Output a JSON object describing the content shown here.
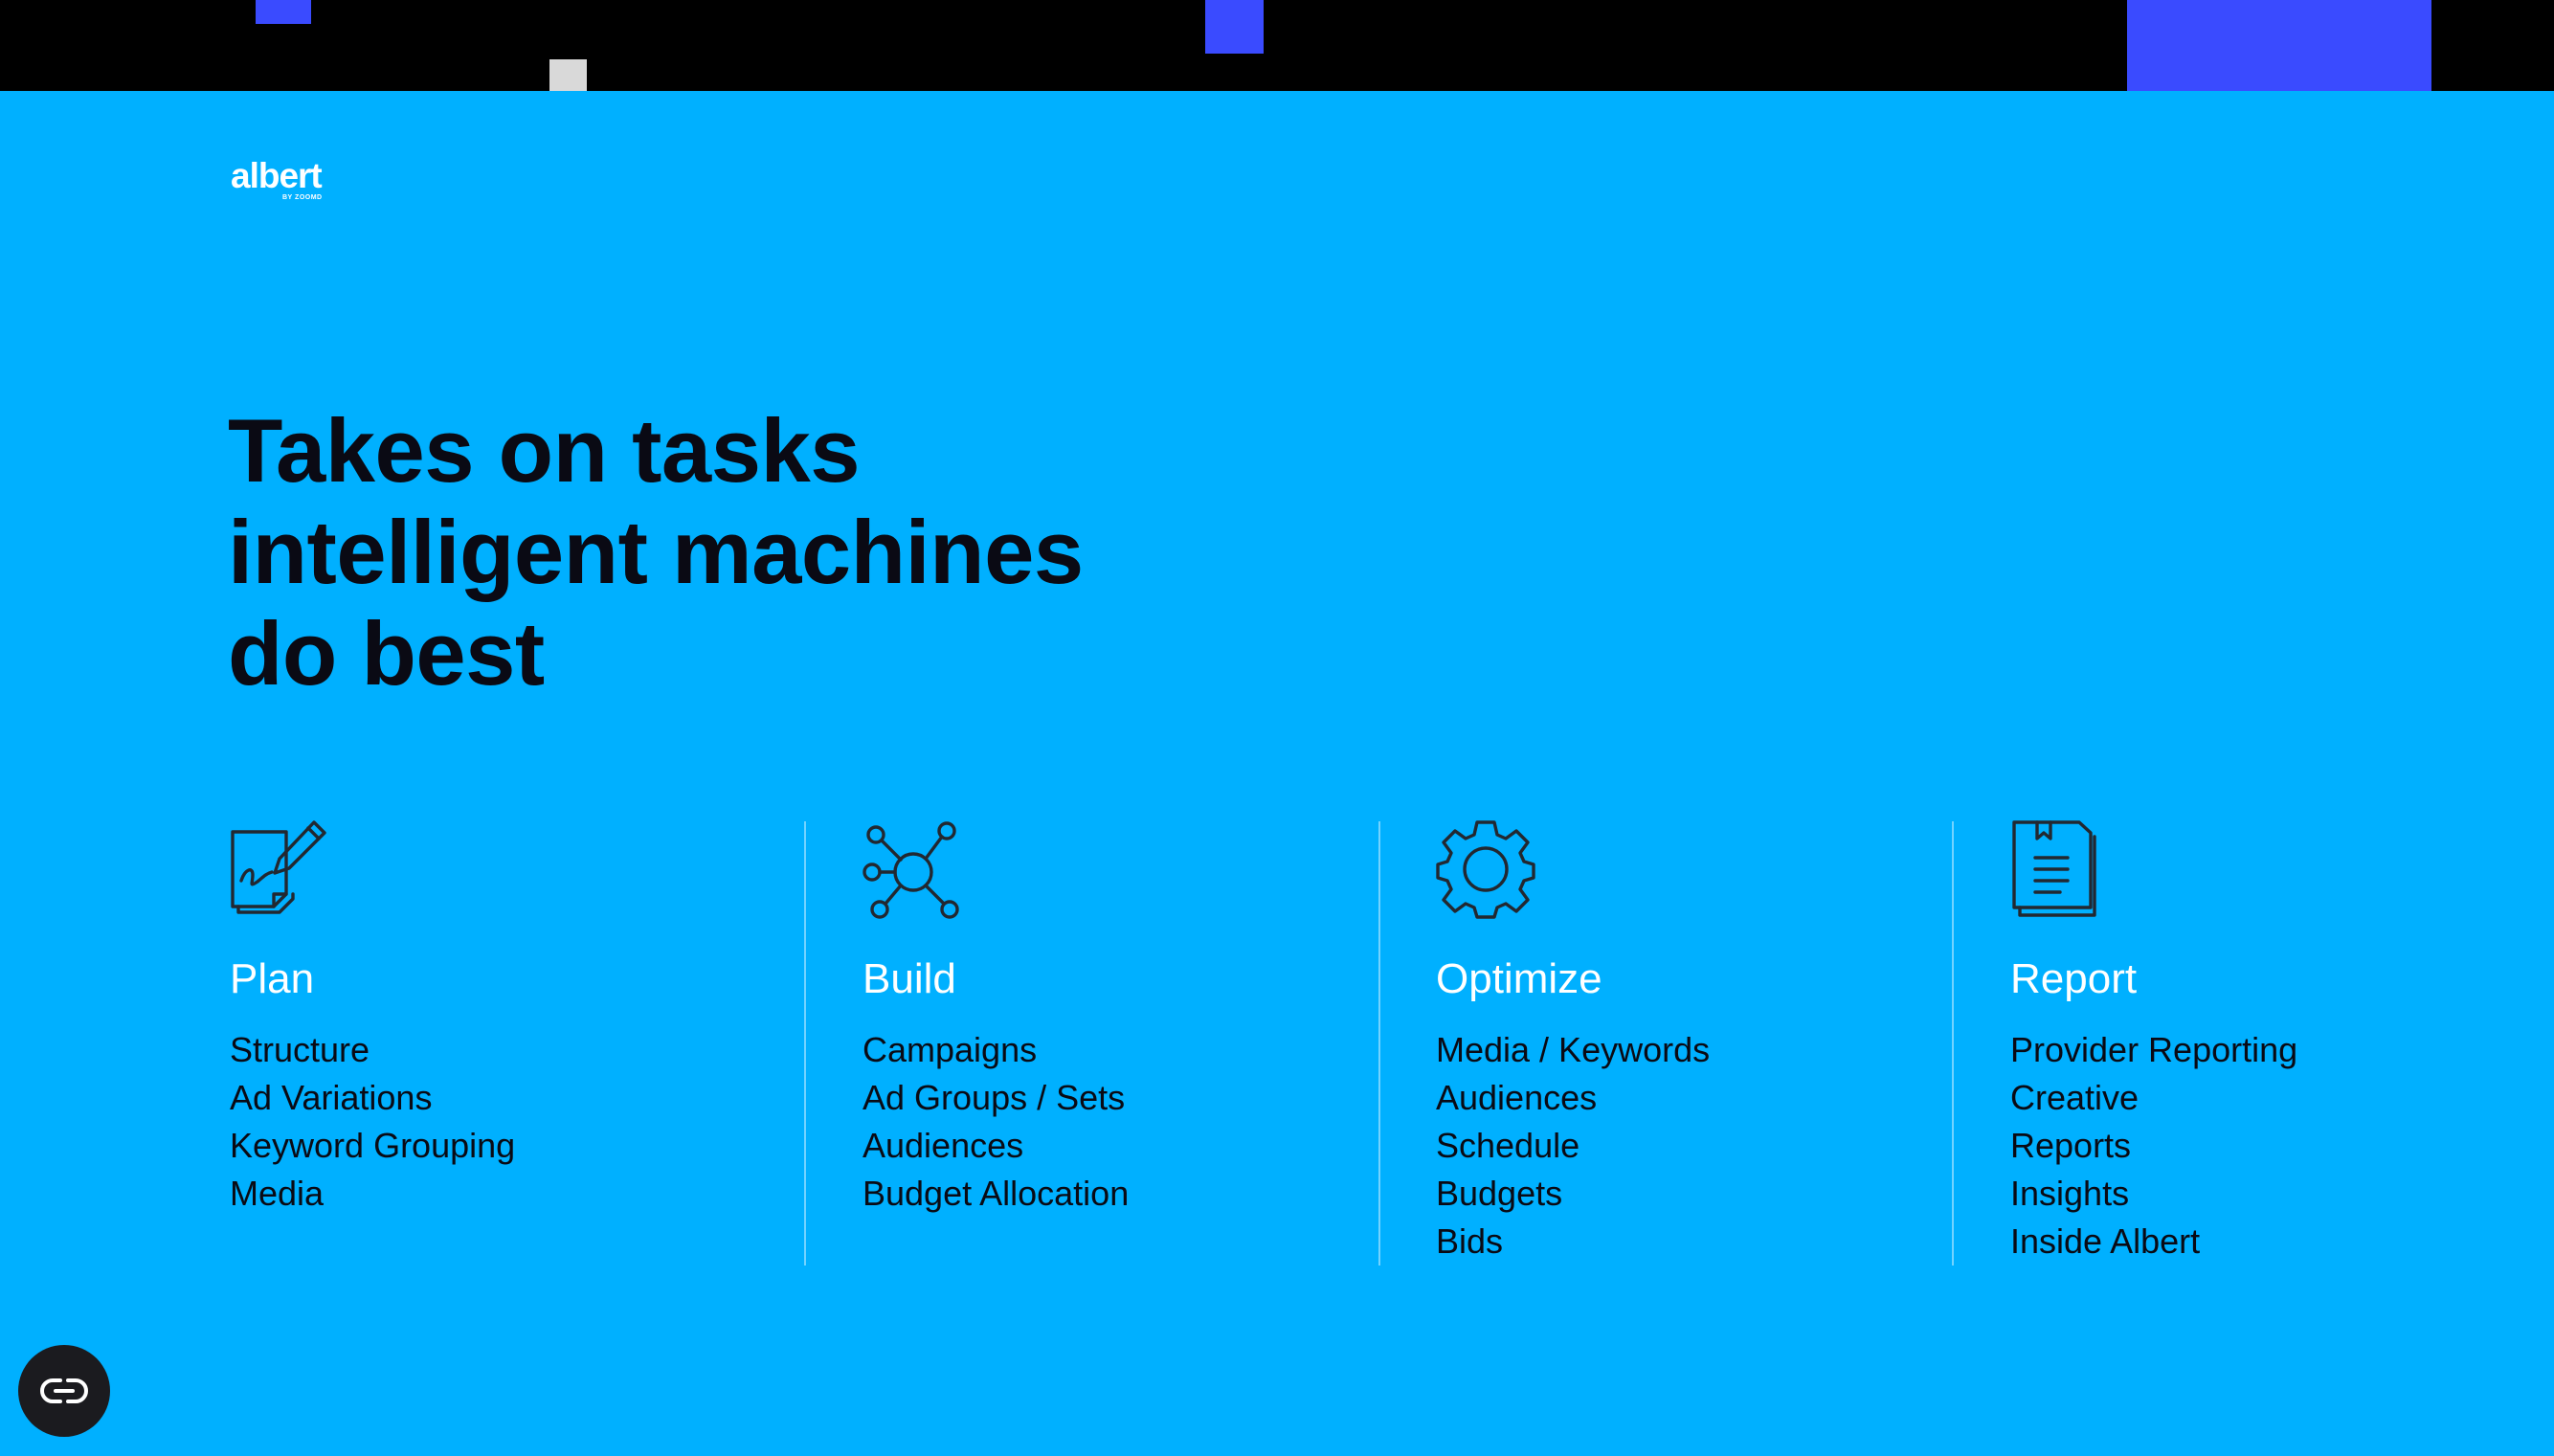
{
  "colors": {
    "background": "#00B0FF",
    "topbar": "#000000",
    "accent_blue": "#3A4BFF",
    "accent_grey": "#D9D9D9",
    "heading_text": "#0A0A14",
    "light_text": "#FFFFFF",
    "fab_background": "#1B1B1F"
  },
  "logo": {
    "word": "albert",
    "tagline": "BY ZOOMD"
  },
  "headline": {
    "lines": [
      "Takes on tasks",
      "intelligent machines",
      "do best"
    ]
  },
  "columns": [
    {
      "icon": "edit-document-icon",
      "title": "Plan",
      "items": [
        "Structure",
        "Ad Variations",
        "Keyword Grouping",
        "Media"
      ]
    },
    {
      "icon": "network-icon",
      "title": "Build",
      "items": [
        "Campaigns",
        "Ad Groups / Sets",
        "Audiences",
        "Budget Allocation"
      ]
    },
    {
      "icon": "gear-icon",
      "title": "Optimize",
      "items": [
        "Media / Keywords",
        "Audiences",
        "Schedule",
        "Budgets",
        "Bids"
      ]
    },
    {
      "icon": "report-document-icon",
      "title": "Report",
      "items": [
        "Provider Reporting",
        "Creative",
        "Reports",
        "Insights",
        "Inside Albert"
      ]
    }
  ],
  "floating_button": {
    "icon": "link-icon"
  }
}
